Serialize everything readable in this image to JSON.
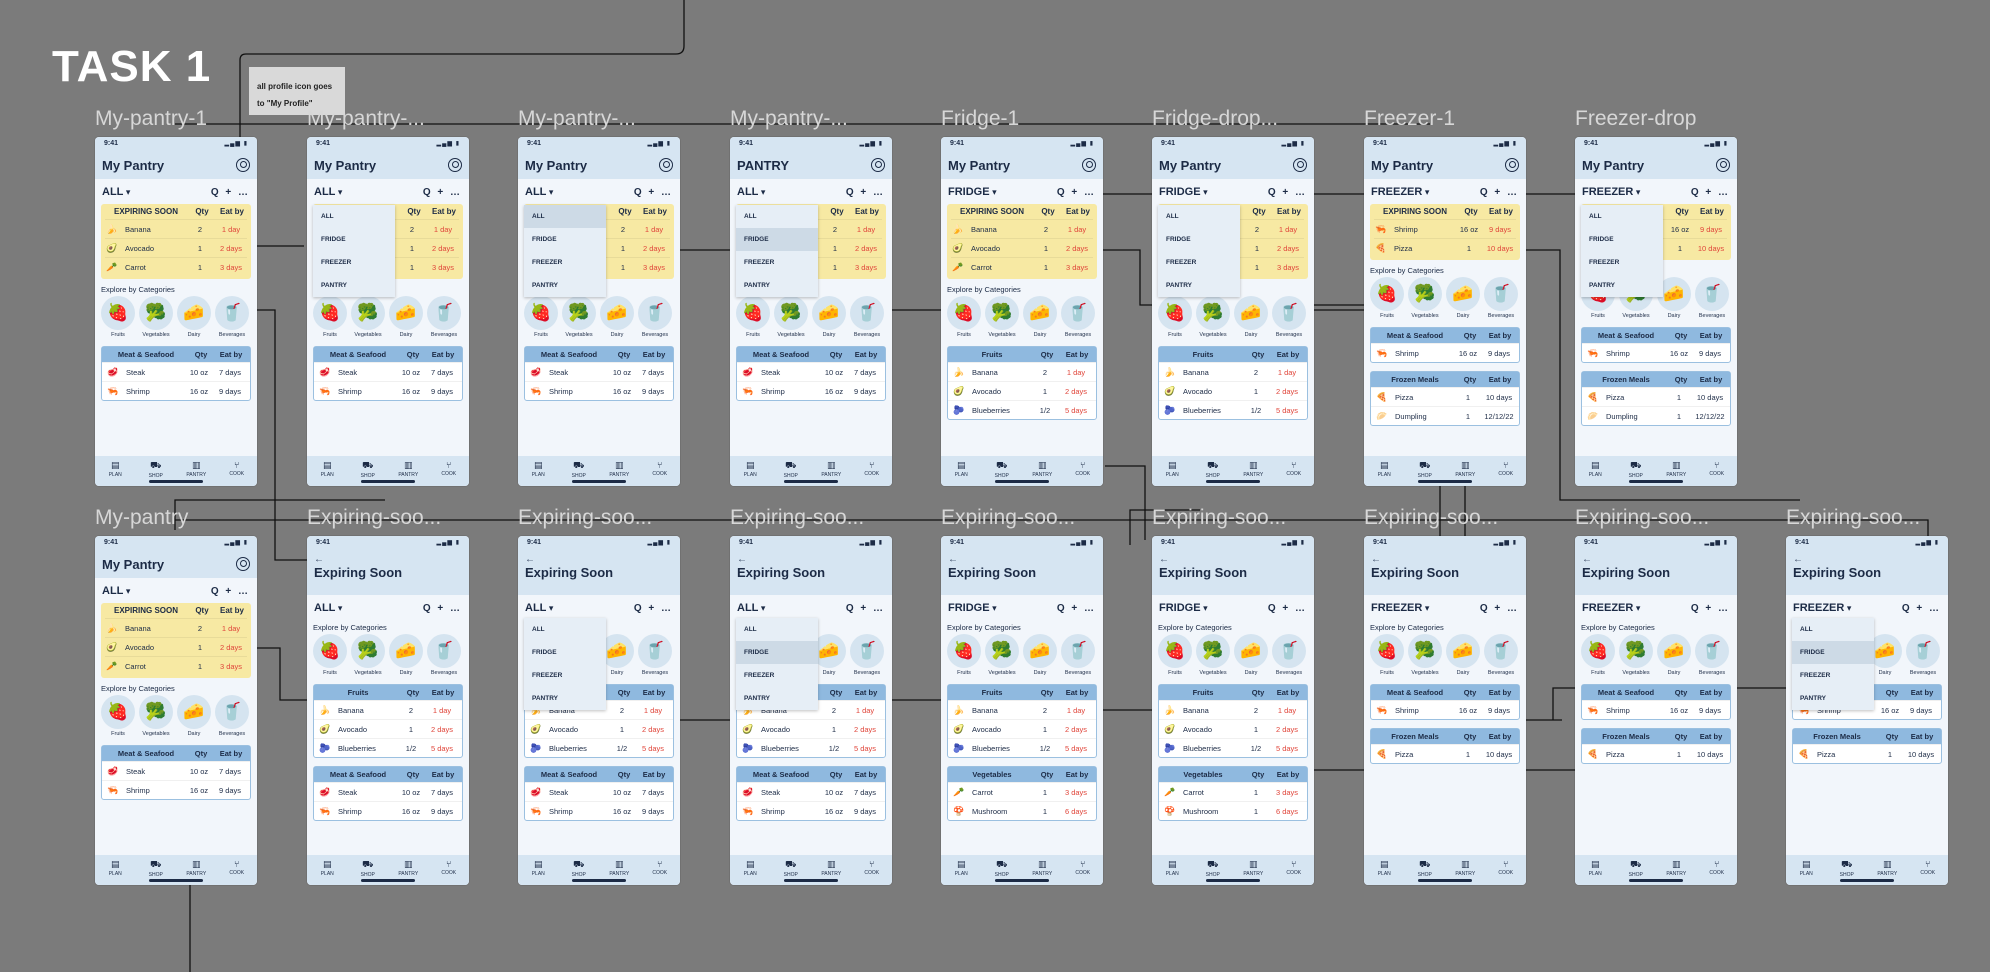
{
  "task_title": "TASK 1",
  "note": "all profile icon goes to \"My Profile\"",
  "filters": [
    "ALL",
    "FRIDGE",
    "FREEZER",
    "PANTRY"
  ],
  "nav": [
    "PLAN",
    "SHOP",
    "PANTRY",
    "COOK"
  ],
  "nav_icons": [
    "plan-icon",
    "shop-icon",
    "pantry-icon",
    "cook-icon"
  ],
  "status_time": "9:41",
  "tools_text": "Q + …",
  "labels": {
    "expiring_soon": "EXPIRING SOON",
    "qty": "Qty",
    "eat_by": "Eat by",
    "explore": "Explore by Categories"
  },
  "categories": [
    {
      "name": "Fruits",
      "icon": "🍓"
    },
    {
      "name": "Vegetables",
      "icon": "🥦"
    },
    {
      "name": "Dairy",
      "icon": "🧀"
    },
    {
      "name": "Beverages",
      "icon": "🥤"
    }
  ],
  "expiring": {
    "main": [
      {
        "icon": "🍌",
        "name": "Banana",
        "qty": "2",
        "eat": "1 day"
      },
      {
        "icon": "🥑",
        "name": "Avocado",
        "qty": "1",
        "eat": "2 days"
      },
      {
        "icon": "🥕",
        "name": "Carrot",
        "qty": "1",
        "eat": "3 days"
      }
    ],
    "freezer": [
      {
        "icon": "🦐",
        "name": "Shrimp",
        "qty": "16 oz",
        "eat": "9 days"
      },
      {
        "icon": "🍕",
        "name": "Pizza",
        "qty": "1",
        "eat": "10 days"
      }
    ]
  },
  "tables": {
    "meat": {
      "title": "Meat & Seafood",
      "rows": [
        {
          "icon": "🥩",
          "name": "Steak",
          "qty": "10 oz",
          "eat": "7 days",
          "red": false
        },
        {
          "icon": "🦐",
          "name": "Shrimp",
          "qty": "16 oz",
          "eat": "9 days",
          "red": false
        }
      ]
    },
    "meat_freezer": {
      "title": "Meat & Seafood",
      "rows": [
        {
          "icon": "🦐",
          "name": "Shrimp",
          "qty": "16 oz",
          "eat": "9 days",
          "red": false
        }
      ]
    },
    "fruits": {
      "title": "Fruits",
      "rows": [
        {
          "icon": "🍌",
          "name": "Banana",
          "qty": "2",
          "eat": "1 day",
          "red": true
        },
        {
          "icon": "🥑",
          "name": "Avocado",
          "qty": "1",
          "eat": "2 days",
          "red": true
        },
        {
          "icon": "🫐",
          "name": "Blueberries",
          "qty": "1/2",
          "eat": "5 days",
          "red": true
        }
      ]
    },
    "vegetables": {
      "title": "Vegetables",
      "rows": [
        {
          "icon": "🥕",
          "name": "Carrot",
          "qty": "1",
          "eat": "3 days",
          "red": true
        },
        {
          "icon": "🍄",
          "name": "Mushroom",
          "qty": "1",
          "eat": "6 days",
          "red": true
        }
      ]
    },
    "frozen_full": {
      "title": "Frozen Meals",
      "rows": [
        {
          "icon": "🍕",
          "name": "Pizza",
          "qty": "1",
          "eat": "10 days",
          "red": false
        },
        {
          "icon": "🥟",
          "name": "Dumpling",
          "qty": "1",
          "eat": "12/12/22",
          "red": false
        }
      ]
    },
    "frozen_short": {
      "title": "Frozen Meals",
      "rows": [
        {
          "icon": "🍕",
          "name": "Pizza",
          "qty": "1",
          "eat": "10 days",
          "red": false
        }
      ]
    }
  },
  "frames": [
    {
      "label": "My-pantry-1",
      "title": "My Pantry",
      "filter": "ALL",
      "exp": "main",
      "tables": [
        "meat"
      ],
      "dd": null,
      "es": false
    },
    {
      "label": "My-pantry-...",
      "title": "My Pantry",
      "filter": "ALL",
      "exp": "main",
      "tables": [
        "meat"
      ],
      "dd": -1,
      "es": false
    },
    {
      "label": "My-pantry-...",
      "title": "My Pantry",
      "filter": "ALL",
      "exp": "main",
      "tables": [
        "meat"
      ],
      "dd": 0,
      "es": false
    },
    {
      "label": "My-pantry-...",
      "title": "PANTRY",
      "filter": "ALL",
      "exp": "main",
      "tables": [
        "meat"
      ],
      "dd": 1,
      "es": false
    },
    {
      "label": "Fridge-1",
      "title": "My Pantry",
      "filter": "FRIDGE",
      "exp": "main",
      "tables": [
        "fruits"
      ],
      "dd": null,
      "es": false
    },
    {
      "label": "Fridge-drop...",
      "title": "My Pantry",
      "filter": "FRIDGE",
      "exp": "main",
      "tables": [
        "fruits"
      ],
      "dd": -1,
      "es": false
    },
    {
      "label": "Freezer-1",
      "title": "My Pantry",
      "filter": "FREEZER",
      "exp": "freezer",
      "tables": [
        "meat_freezer",
        "frozen_full"
      ],
      "dd": null,
      "es": false
    },
    {
      "label": "Freezer-drop",
      "title": "My Pantry",
      "filter": "FREEZER",
      "exp": "freezer",
      "tables": [
        "meat_freezer",
        "frozen_full"
      ],
      "dd": -1,
      "es": false
    },
    {
      "label": "My-pantry",
      "title": "My Pantry",
      "filter": "ALL",
      "exp": "main",
      "tables": [
        "meat"
      ],
      "dd": null,
      "es": false
    },
    {
      "label": "Expiring-soo...",
      "title": "Expiring Soon",
      "filter": "ALL",
      "exp": null,
      "tables": [
        "fruits",
        "meat"
      ],
      "dd": null,
      "es": true
    },
    {
      "label": "Expiring-soo...",
      "title": "Expiring Soon",
      "filter": "ALL",
      "exp": null,
      "tables": [
        "fruits",
        "meat"
      ],
      "dd": -1,
      "es": true
    },
    {
      "label": "Expiring-soo...",
      "title": "Expiring Soon",
      "filter": "ALL",
      "exp": null,
      "tables": [
        "fruits",
        "meat"
      ],
      "dd": 1,
      "es": true
    },
    {
      "label": "Expiring-soo...",
      "title": "Expiring Soon",
      "filter": "FRIDGE",
      "exp": null,
      "tables": [
        "fruits",
        "vegetables"
      ],
      "dd": null,
      "es": true
    },
    {
      "label": "Expiring-soo...",
      "title": "Expiring Soon",
      "filter": "FRIDGE",
      "exp": null,
      "tables": [
        "fruits",
        "vegetables"
      ],
      "dd": null,
      "es": true
    },
    {
      "label": "Expiring-soo...",
      "title": "Expiring Soon",
      "filter": "FREEZER",
      "exp": null,
      "tables": [
        "meat_freezer",
        "frozen_short"
      ],
      "dd": null,
      "es": true
    },
    {
      "label": "Expiring-soo...",
      "title": "Expiring Soon",
      "filter": "FREEZER",
      "exp": null,
      "tables": [
        "meat_freezer",
        "frozen_short"
      ],
      "dd": null,
      "es": true
    },
    {
      "label": "Expiring-soo...",
      "title": "Expiring Soon",
      "filter": "FREEZER",
      "exp": null,
      "tables": [
        "meat_freezer",
        "frozen_short"
      ],
      "dd": 1,
      "es": true
    }
  ]
}
